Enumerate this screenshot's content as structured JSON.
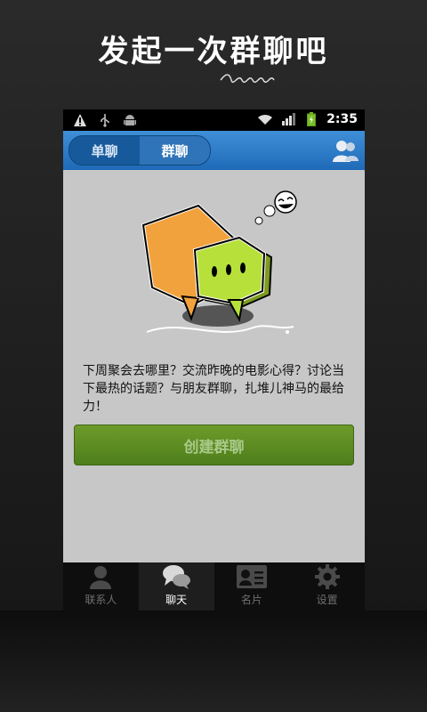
{
  "promo": {
    "title": "发起一次群聊吧"
  },
  "status_bar": {
    "time": "2:35",
    "icons": [
      "warning-icon",
      "usb-icon",
      "android-icon",
      "wifi-icon",
      "signal-icon",
      "battery-icon"
    ]
  },
  "header": {
    "tabs": [
      {
        "label": "单聊",
        "active": false
      },
      {
        "label": "群聊",
        "active": true
      }
    ]
  },
  "main": {
    "description": "下周聚会去哪里？交流昨晚的电影心得？讨论当下最热的话题？与朋友群聊，扎堆儿神马的最给力！",
    "create_button": "创建群聊"
  },
  "bottom_nav": {
    "items": [
      {
        "label": "联系人",
        "icon": "person-icon",
        "active": false
      },
      {
        "label": "聊天",
        "icon": "chat-bubbles-icon",
        "active": true
      },
      {
        "label": "名片",
        "icon": "card-icon",
        "active": false
      },
      {
        "label": "设置",
        "icon": "gear-icon",
        "active": false
      }
    ]
  },
  "colors": {
    "accent_blue": "#2f73b8",
    "button_green": "#5b8c22",
    "bubble_orange": "#f2a23c",
    "bubble_green": "#b7e13a"
  }
}
